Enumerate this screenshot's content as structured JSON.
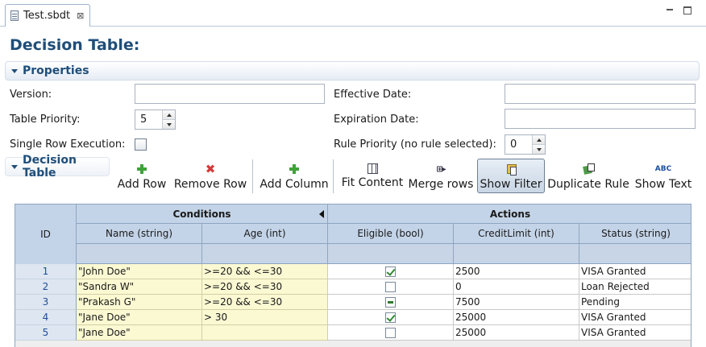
{
  "tab": {
    "title": "Test.sbdt",
    "close": "⊠"
  },
  "page": {
    "title": "Decision Table:"
  },
  "properties": {
    "title": "Properties",
    "version_label": "Version:",
    "version_value": "",
    "table_priority_label": "Table Priority:",
    "table_priority_value": "5",
    "single_row_label": "Single Row Execution:",
    "single_row_checked": false,
    "effective_date_label": "Effective Date:",
    "effective_date_value": "",
    "expiration_date_label": "Expiration Date:",
    "expiration_date_value": "",
    "rule_priority_label": "Rule Priority (no rule selected):",
    "rule_priority_value": "0"
  },
  "decision_table": {
    "title": "Decision Table",
    "toolbar": {
      "add_row": "Add Row",
      "remove_row": "Remove Row",
      "add_column": "Add Column",
      "fit_content": "Fit Content",
      "merge_rows": "Merge rows",
      "show_filter": "Show Filter",
      "duplicate_rule": "Duplicate Rule",
      "show_text": "Show Text",
      "merge_icon_glyph": "⊞▸",
      "show_text_icon_glyph": "ABC"
    },
    "grid": {
      "id_header": "ID",
      "conditions_header": "Conditions",
      "actions_header": "Actions",
      "columns": [
        "Name (string)",
        "Age (int)",
        "Eligible (bool)",
        "CreditLimit (int)",
        "Status (string)"
      ],
      "rows": [
        {
          "id": "1",
          "name": "\"John Doe\"",
          "age": ">=20 && <=30",
          "eligible": "checked",
          "credit": "2500",
          "status": "VISA Granted"
        },
        {
          "id": "2",
          "name": "\"Sandra W\"",
          "age": ">=20 && <=30",
          "eligible": "unchecked",
          "credit": "0",
          "status": "Loan Rejected"
        },
        {
          "id": "3",
          "name": "\"Prakash G\"",
          "age": ">=20 && <=30",
          "eligible": "indeterminate",
          "credit": "7500",
          "status": "Pending"
        },
        {
          "id": "4",
          "name": "\"Jane Doe\"",
          "age": "> 30",
          "eligible": "checked",
          "credit": "25000",
          "status": "VISA Granted"
        },
        {
          "id": "5",
          "name": "\"Jane Doe\"",
          "age": "",
          "eligible": "unchecked",
          "credit": "25000",
          "status": "VISA Granted"
        }
      ]
    }
  },
  "colors": {
    "accent": "#1f4e79",
    "header_bg": "#c4d4e8",
    "condition_bg": "#fbf9d2"
  }
}
